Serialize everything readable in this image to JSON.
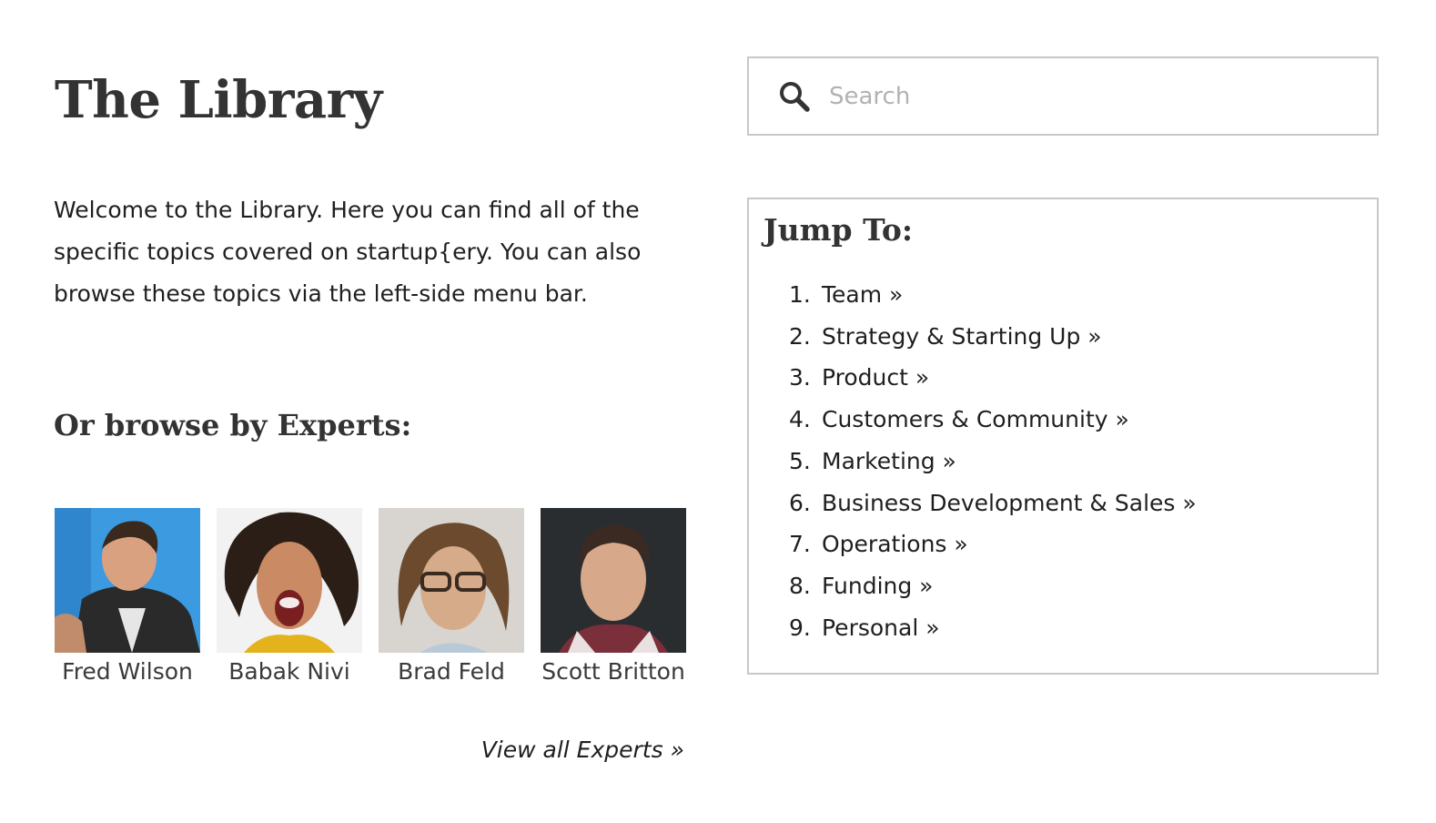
{
  "header": {
    "title": "The Library"
  },
  "intro": {
    "text": "Welcome to the Library. Here you can find all of the specific topics covered on startup{ery. You can also browse these topics via the left-side menu bar."
  },
  "experts": {
    "heading": "Or browse by Experts:",
    "items": [
      {
        "name": "Fred Wilson"
      },
      {
        "name": "Babak Nivi"
      },
      {
        "name": "Brad Feld"
      },
      {
        "name": "Scott Britton"
      }
    ],
    "view_all_label": "View all Experts »"
  },
  "search": {
    "placeholder": "Search",
    "value": ""
  },
  "jump_to": {
    "title": "Jump To:",
    "items": [
      {
        "number": "1.",
        "label": "Team »"
      },
      {
        "number": "2.",
        "label": "Strategy & Starting Up »"
      },
      {
        "number": "3.",
        "label": "Product »"
      },
      {
        "number": "4.",
        "label": "Customers & Community »"
      },
      {
        "number": "5.",
        "label": "Marketing »"
      },
      {
        "number": "6.",
        "label": "Business Development & Sales »"
      },
      {
        "number": "7.",
        "label": "Operations »"
      },
      {
        "number": "8.",
        "label": "Funding »"
      },
      {
        "number": "9.",
        "label": "Personal »"
      }
    ]
  },
  "colors": {
    "text": "#2b2b2b",
    "border": "#c8c8c8",
    "placeholder": "#b2b2b2"
  }
}
